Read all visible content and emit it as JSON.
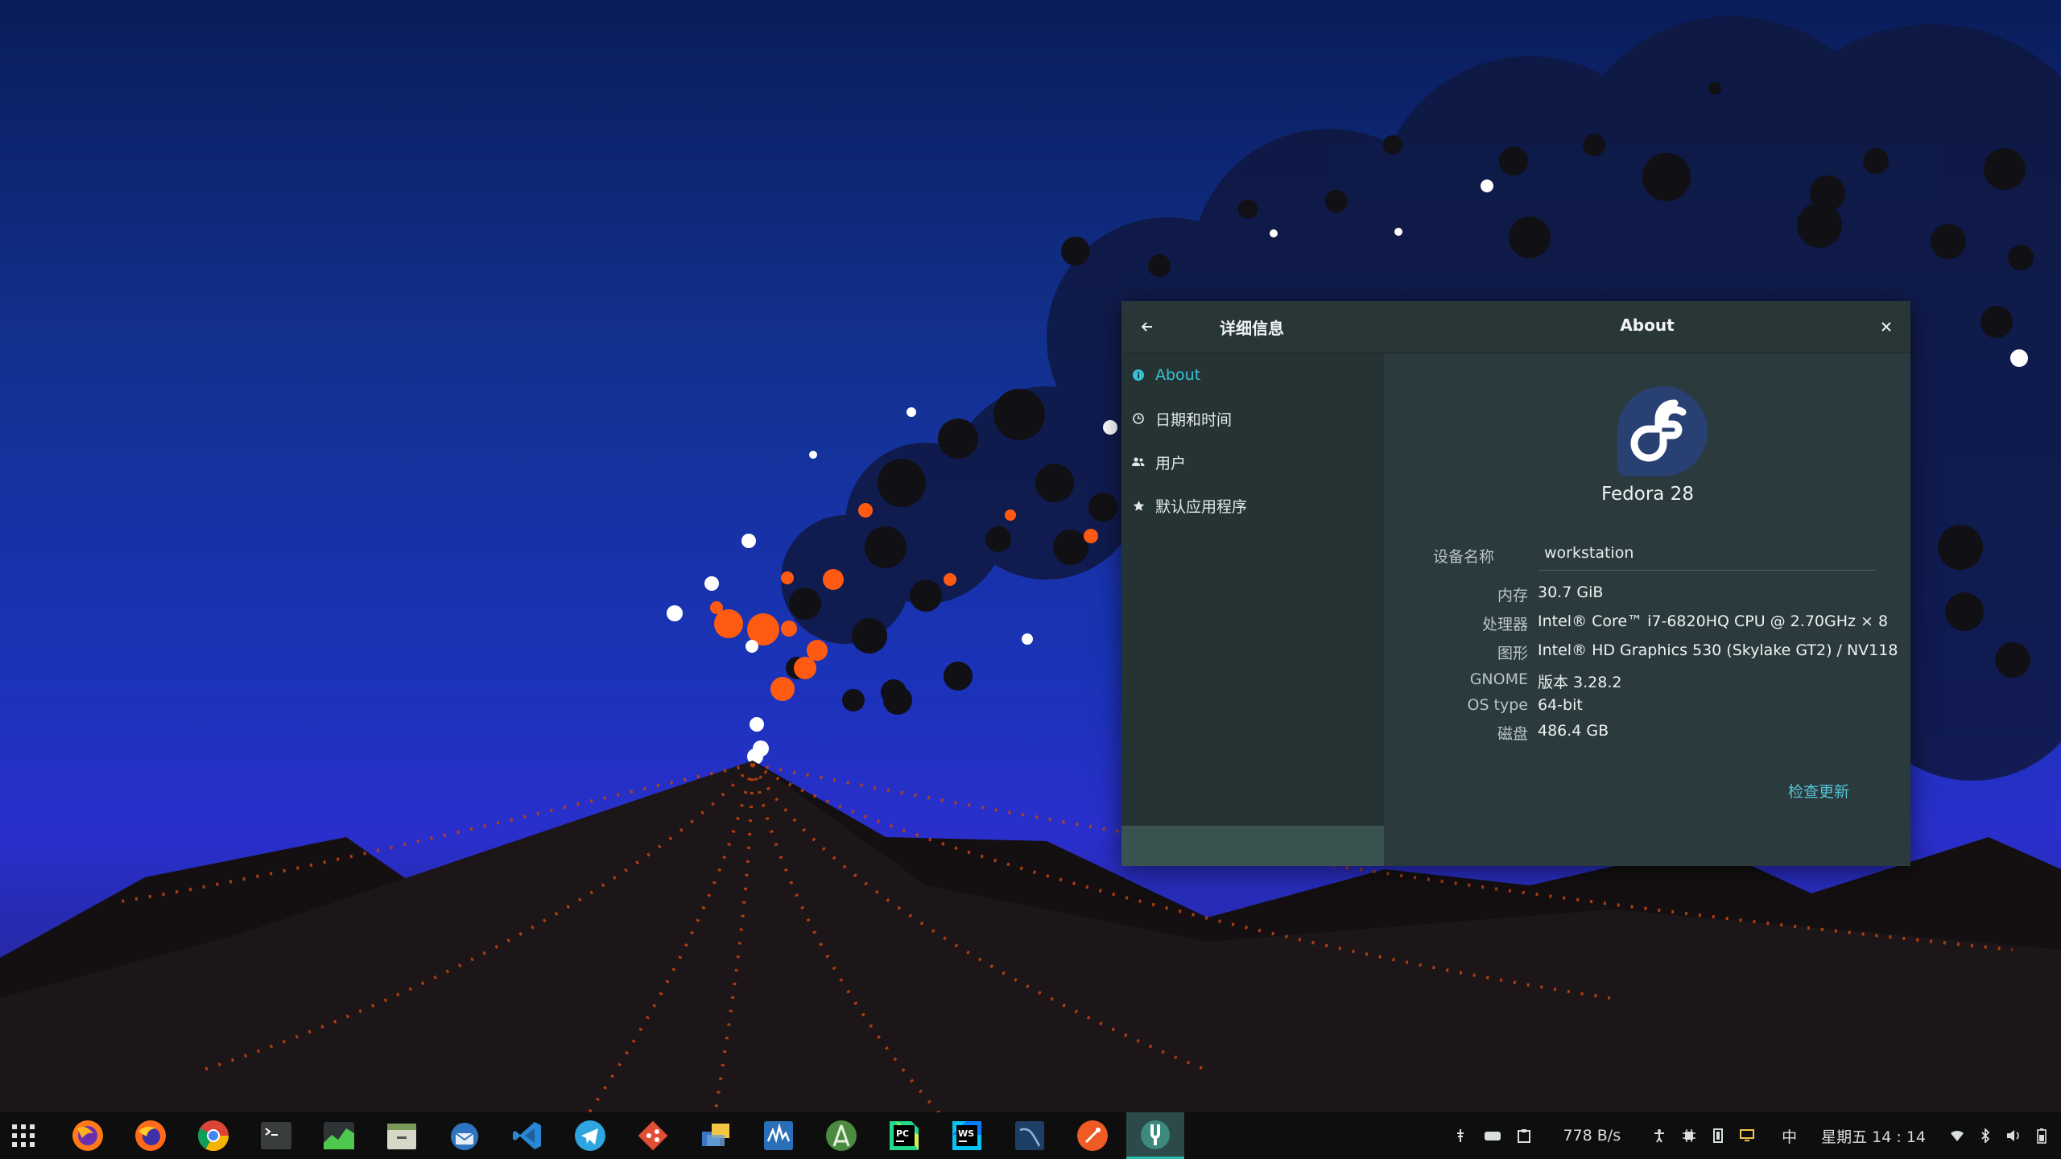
{
  "window": {
    "sidebar_title": "详细信息",
    "content_title": "About",
    "sidebar_items": [
      {
        "label": "About",
        "icon": "info-icon",
        "active": true
      },
      {
        "label": "日期和时间",
        "icon": "clock-icon",
        "active": false
      },
      {
        "label": "用户",
        "icon": "users-icon",
        "active": false
      },
      {
        "label": "默认应用程序",
        "icon": "star-icon",
        "active": false
      }
    ],
    "os_name": "Fedora 28",
    "device_label": "设备名称",
    "device_name": "workstation",
    "details": [
      {
        "key": "内存",
        "value": "30.7 GiB"
      },
      {
        "key": "处理器",
        "value": "Intel® Core™ i7-6820HQ CPU @ 2.70GHz × 8"
      },
      {
        "key": "图形",
        "value": "Intel® HD Graphics 530 (Skylake GT2) / NV118"
      },
      {
        "key": "GNOME",
        "value": "版本 3.28.2"
      },
      {
        "key": "OS type",
        "value": "64-bit"
      },
      {
        "key": "磁盘",
        "value": "486.4 GB"
      }
    ],
    "update_button": "检查更新",
    "accent_color": "#37c2d3"
  },
  "taskbar": {
    "apps": [
      {
        "name": "firefox-icon"
      },
      {
        "name": "firefox-alt-icon"
      },
      {
        "name": "chrome-icon"
      },
      {
        "name": "terminal-icon"
      },
      {
        "name": "system-monitor-icon"
      },
      {
        "name": "files-icon"
      },
      {
        "name": "thunderbird-icon"
      },
      {
        "name": "vscode-icon"
      },
      {
        "name": "telegram-icon"
      },
      {
        "name": "git-icon"
      },
      {
        "name": "virtualbox-icon"
      },
      {
        "name": "wireshark-icon"
      },
      {
        "name": "android-studio-icon"
      },
      {
        "name": "pycharm-icon"
      },
      {
        "name": "webstorm-icon"
      },
      {
        "name": "mysql-workbench-icon"
      },
      {
        "name": "postman-icon"
      },
      {
        "name": "settings-icon",
        "active": true
      }
    ],
    "tray": {
      "net_speed": "778 B/s",
      "input_method": "中",
      "clock": "星期五 14 : 14"
    }
  }
}
